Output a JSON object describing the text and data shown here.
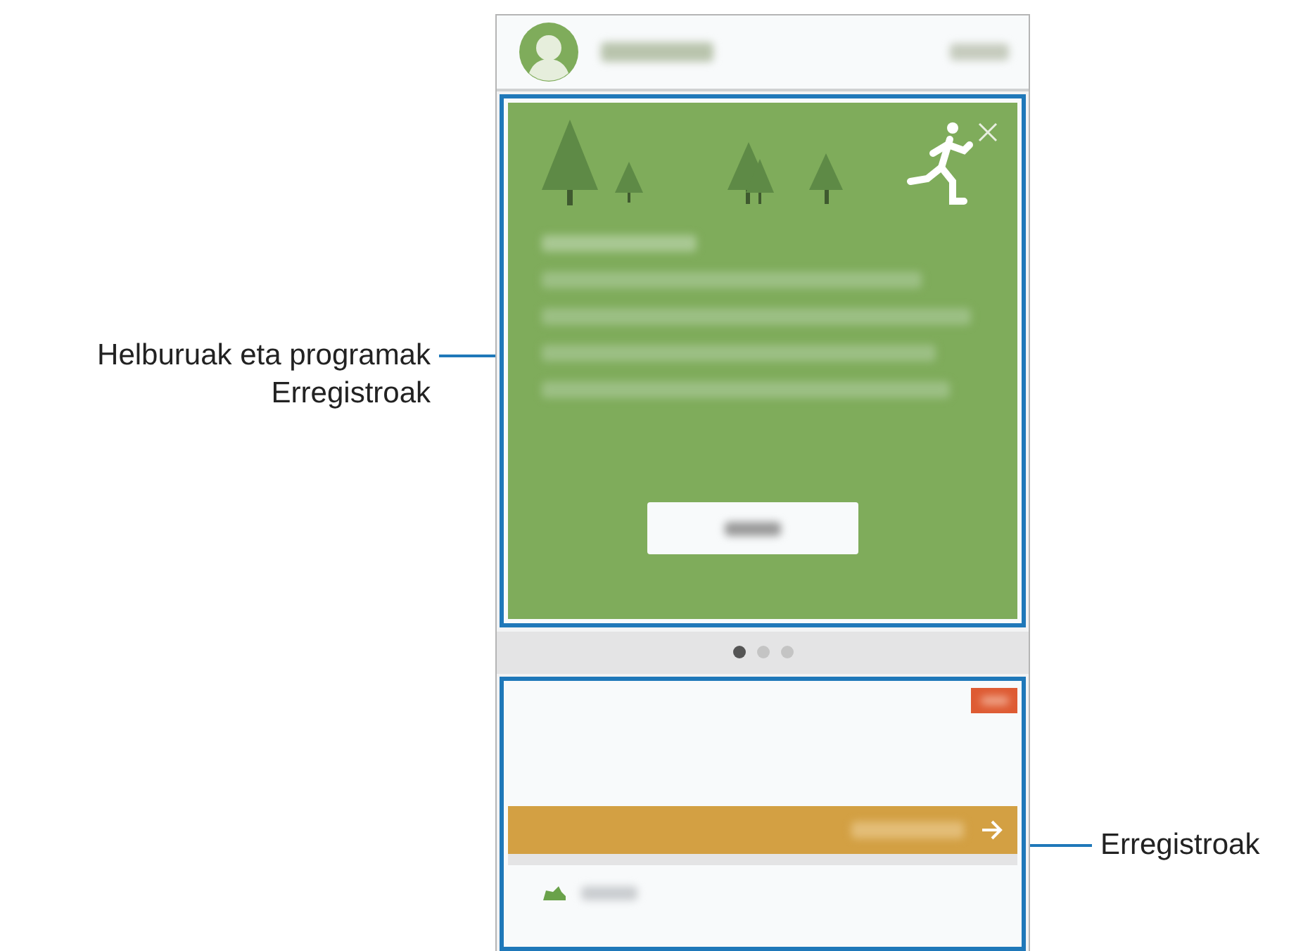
{
  "callouts": [
    {
      "kind": "left",
      "lines": [
        "Helburuak eta programak",
        "Erregistroak"
      ]
    },
    {
      "kind": "right",
      "lines": [
        "Erregistroak"
      ]
    }
  ],
  "page_dots": [
    {
      "selected": true
    },
    {
      "selected": false
    },
    {
      "selected": false
    }
  ]
}
